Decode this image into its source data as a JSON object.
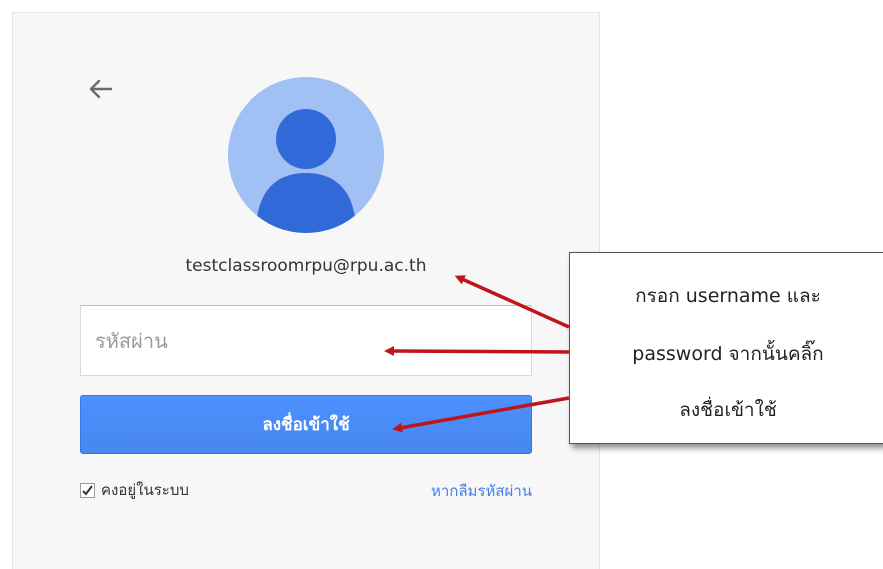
{
  "signin": {
    "email": "testclassroomrpu@rpu.ac.th",
    "password_placeholder": "รหัสผ่าน",
    "signin_label": "ลงชื่อเข้าใช้",
    "stay_signed_in_label": "คงอยู่ในระบบ",
    "stay_signed_in_checked": true,
    "forgot_password_label": "หากลืมรหัสผ่าน"
  },
  "callout": {
    "lines": [
      "กรอก username และ",
      "password จากนั้นคลิ๊ก",
      "ลงชื่อเข้าใช้"
    ]
  },
  "icons": {
    "back": "arrow-left-icon",
    "avatar": "default-user-avatar-icon",
    "checkbox": "check-icon"
  },
  "colors": {
    "primary_button": "#4d90fe",
    "link": "#427fed",
    "avatar_bg": "#a1c0f4",
    "avatar_figure": "#3169d8",
    "annotation_arrow": "#c0141b"
  }
}
